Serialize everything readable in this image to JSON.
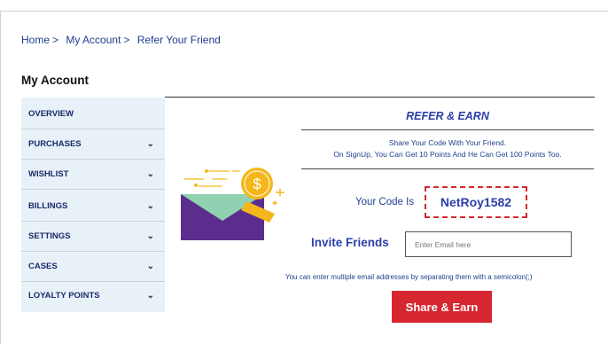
{
  "breadcrumb": {
    "items": [
      "Home",
      "My Account",
      "Refer Your Friend"
    ],
    "separator": ">"
  },
  "page_title": "My Account",
  "sidebar": {
    "items": [
      {
        "label": "OVERVIEW",
        "has_chevron": false
      },
      {
        "label": "PURCHASES",
        "has_chevron": true
      },
      {
        "label": "WISHLIST",
        "has_chevron": true
      },
      {
        "label": "BILLINGS",
        "has_chevron": true
      },
      {
        "label": "SETTINGS",
        "has_chevron": true
      },
      {
        "label": "CASES",
        "has_chevron": true
      },
      {
        "label": "LOYALTY POINTS",
        "has_chevron": true
      }
    ],
    "chevron": "⌄",
    "background": "#e8f1f7"
  },
  "refer": {
    "title": "REFER & EARN",
    "desc_line1": "Share Your Code With Your Friend.",
    "desc_line2": "On SignUp, You Can Get 10 Points And He Can Get 100 Points Too.",
    "illustration_icon": "envelope-coin-icon",
    "coin_symbol": "$"
  },
  "code": {
    "label": "Your Code Is",
    "value": "NetRoy1582"
  },
  "invite": {
    "label": "Invite Friends",
    "placeholder": "Enter Email here",
    "value": "",
    "helper": "You can enter multiple email addresses by separating them with a semicolon(;)"
  },
  "share_button": "Share & Earn",
  "colors": {
    "accent_red": "#d6262f",
    "brand_blue": "#2b3fa8",
    "envelope_purple": "#5b2d8c",
    "envelope_flap": "#8fd1b0",
    "coin_gold": "#f5b61c"
  }
}
